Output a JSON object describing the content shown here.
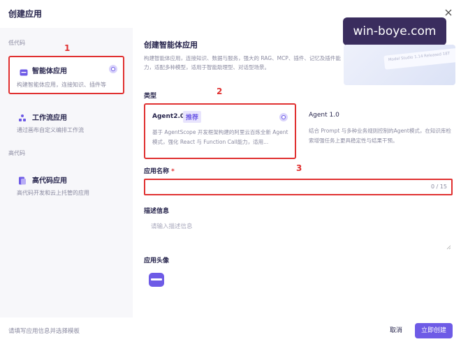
{
  "dialog": {
    "title": "创建应用",
    "close_icon": "close-icon"
  },
  "watermark": "win-boye.com",
  "sidebar": {
    "groups": [
      {
        "label": "低代码",
        "items": [
          {
            "label": "智能体应用",
            "desc": "构建智能体应用，连接知识、插件等",
            "icon": "agent-app-icon",
            "selected": true
          },
          {
            "label": "工作流应用",
            "desc": "通过画布自定义编排工作流",
            "icon": "workflow-app-icon",
            "selected": false
          }
        ]
      },
      {
        "label": "高代码",
        "items": [
          {
            "label": "高代码应用",
            "desc": "高代码开发和云上托管的应用",
            "icon": "code-app-icon",
            "selected": false
          }
        ]
      }
    ]
  },
  "annotations": [
    "1",
    "2",
    "3"
  ],
  "main": {
    "title": "创建智能体应用",
    "desc": "构建智能体应用，连接知识、数据与服务，强大的 RAG、MCP、插件、记忆及插件能力，适配多种模型，适用于智能助理型、对话型场景。",
    "promo_text": "Model Studio 1.14 Released 18T"
  },
  "type_section": {
    "label": "类型",
    "cards": [
      {
        "name": "Agent2.0",
        "badge": "推荐",
        "desc": "基于 AgentScope 开发框架构建的阿里云百炼全新 Agent 模式，强化 React 与 Function Call能力，适用...",
        "selected": true
      },
      {
        "name": "Agent 1.0",
        "badge": "",
        "desc": "结合 Prompt 与多种业务规则控制的Agent模式，在知识库检索增强任务上更具稳定性与结果干预。",
        "selected": false
      }
    ]
  },
  "name_field": {
    "label": "应用名称",
    "required_mark": "*",
    "value": "",
    "counter": "0 / 15"
  },
  "desc_field": {
    "label": "描述信息",
    "placeholder": "请输入描述信息"
  },
  "avatar_field": {
    "label": "应用头像",
    "icon": "app-avatar-icon"
  },
  "footer": {
    "hint": "请填写应用信息并选择模板",
    "cancel_label": "取消",
    "create_label": "立即创建"
  },
  "colors": {
    "accent": "#6e5be6",
    "annotation_red": "#e03030",
    "sidebar_bg": "#f7f7fa"
  }
}
